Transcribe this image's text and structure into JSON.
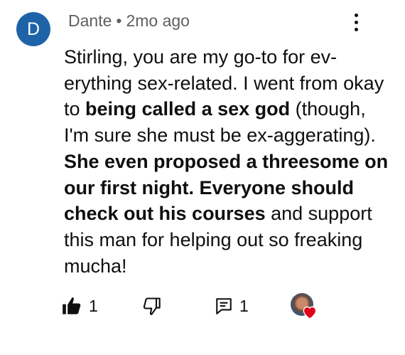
{
  "comment": {
    "avatar_letter": "D",
    "author": "Dante",
    "separator": "•",
    "time": "2mo ago",
    "text": {
      "p1": "Stirling, you are my go-to for ev-erything sex-related. I went from okay to ",
      "b1": "being called a sex god",
      "p2": " (though, I'm sure she must be ex-aggerating). ",
      "b2": "She even proposed a threesome on our first night. Everyone should check out his courses",
      "p3": " and support this man for helping out so freaking mucha!"
    }
  },
  "actions": {
    "like_count": "1",
    "reply_count": "1",
    "liked_by_creator": true
  },
  "icons": [
    "more-vert-icon",
    "thumbs-up-icon",
    "thumbs-down-icon",
    "reply-icon",
    "creator-heart-icon"
  ],
  "colors": {
    "avatar_bg": "#1e63a8",
    "text": "#0f0f0f",
    "meta": "#606060",
    "heart": "#e0001b"
  }
}
